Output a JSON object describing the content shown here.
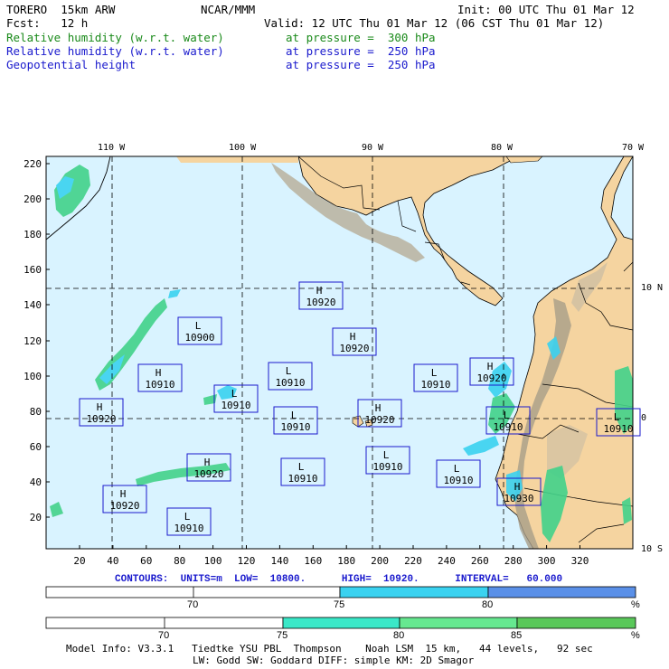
{
  "header": {
    "model": "TORERO  15km ARW",
    "org": "NCAR/MMM",
    "init": "Init: 00 UTC Thu 01 Mar 12",
    "fcst": "Fcst:   12 h",
    "valid": "Valid: 12 UTC Thu 01 Mar 12 (06 CST Thu 01 Mar 12)",
    "fields": [
      {
        "name": "Relative humidity (w.r.t. water)",
        "level": "at pressure =  300 hPa",
        "color": "#1a8a1a"
      },
      {
        "name": "Relative humidity (w.r.t. water)",
        "level": "at pressure =  250 hPa",
        "color": "#1a1acd"
      },
      {
        "name": "Geopotential height",
        "level": "at pressure =  250 hPa",
        "color": "#1a1acd"
      }
    ]
  },
  "map": {
    "lon_labels": [
      "110 W",
      "100 W",
      "90 W",
      "80 W",
      "70 W"
    ],
    "lat_labels": [
      "10 N",
      "0",
      "10 S"
    ],
    "y_ticks": [
      "220",
      "200",
      "180",
      "160",
      "140",
      "120",
      "100",
      "80",
      "60",
      "40",
      "20"
    ],
    "x_ticks": [
      "20",
      "40",
      "60",
      "80",
      "100",
      "120",
      "140",
      "160",
      "180",
      "200",
      "220",
      "240",
      "260",
      "280",
      "300",
      "320"
    ],
    "centers": [
      {
        "type": "H",
        "value": "10920"
      },
      {
        "type": "L",
        "value": "10900"
      },
      {
        "type": "H",
        "value": "10920"
      },
      {
        "type": "H",
        "value": "10910"
      },
      {
        "type": "L",
        "value": "10910"
      },
      {
        "type": "L",
        "value": "10910"
      },
      {
        "type": "H",
        "value": "10920"
      },
      {
        "type": "H",
        "value": "10920"
      },
      {
        "type": "L",
        "value": "10910"
      },
      {
        "type": "H",
        "value": "10920"
      },
      {
        "type": "L",
        "value": "10910"
      },
      {
        "type": "L",
        "value": "10910"
      },
      {
        "type": "H",
        "value": "10920"
      },
      {
        "type": "L",
        "value": "10910"
      },
      {
        "type": "H",
        "value": "10920"
      },
      {
        "type": "L",
        "value": "10910"
      },
      {
        "type": "L",
        "value": "10910"
      },
      {
        "type": "L",
        "value": "10910"
      },
      {
        "type": "H",
        "value": "10930"
      },
      {
        "type": "L",
        "value": "10910"
      }
    ]
  },
  "contours": {
    "text": "CONTOURS:  UNITS=m  LOW=  10800.      HIGH=  10920.      INTERVAL=   60.000"
  },
  "colorbar_250": {
    "labels": [
      "70",
      "75",
      "80",
      "%"
    ],
    "colors": [
      "#ffffff",
      "#3ad2f0",
      "#5a90e8"
    ]
  },
  "colorbar_300": {
    "labels": [
      "70",
      "75",
      "80",
      "85",
      "%"
    ],
    "colors": [
      "#ffffff",
      "#3ae8c8",
      "#66e890",
      "#5ac85a"
    ]
  },
  "footer": {
    "line1": "Model Info: V3.3.1   Tiedtke YSU PBL  Thompson    Noah LSM  15 km,   44 levels,   92 sec",
    "line2": "LW: Godd SW: Goddard DIFF: simple KM: 2D Smagor"
  },
  "colors": {
    "ocean": "#d9f3ff",
    "land": "#f5d4a0",
    "terrain": "#b4a890",
    "box": "#1a1acd",
    "humid_green": "#42d28a",
    "humid_cyan": "#3ad2f0"
  }
}
